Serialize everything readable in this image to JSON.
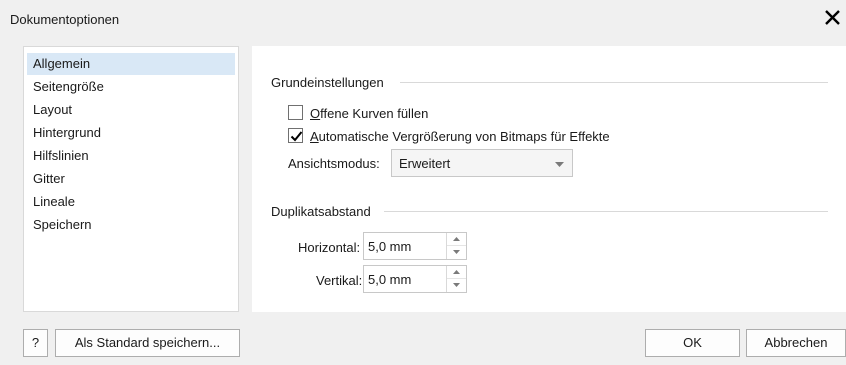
{
  "window": {
    "title": "Dokumentoptionen"
  },
  "sidebar": {
    "items": [
      {
        "label": "Allgemein"
      },
      {
        "label": "Seitengröße"
      },
      {
        "label": "Layout"
      },
      {
        "label": "Hintergrund"
      },
      {
        "label": "Hilfslinien"
      },
      {
        "label": "Gitter"
      },
      {
        "label": "Lineale"
      },
      {
        "label": "Speichern"
      }
    ],
    "selected": "Allgemein"
  },
  "grundeinstellungen": {
    "title": "Grundeinstellungen",
    "fill_open_curves": {
      "label_first": "O",
      "label_rest": "ffene Kurven füllen",
      "checked": false
    },
    "auto_enlarge": {
      "label_first": "A",
      "label_rest": "utomatische Vergrößerung von Bitmaps für Effekte",
      "checked": true
    },
    "view_mode": {
      "label": "Ansichtsmodus:",
      "value": "Erweitert"
    }
  },
  "duplikatsabstand": {
    "title": "Duplikatsabstand",
    "horizontal": {
      "label": "Horizontal:",
      "value": "5,0 mm"
    },
    "vertical": {
      "label": "Vertikal:",
      "value": "5,0 mm"
    }
  },
  "footer": {
    "help_label": "?",
    "save_default_label": "Als Standard speichern...",
    "ok_label": "OK",
    "cancel_label": "Abbrechen"
  }
}
